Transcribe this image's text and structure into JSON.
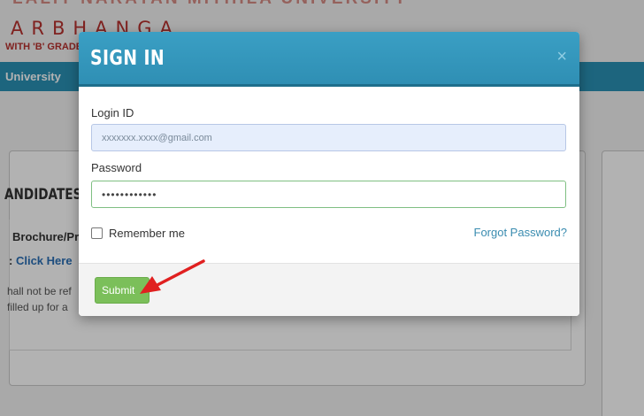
{
  "background": {
    "university_name": "LALIT NARAYAN MITHILA UNIVERSITY",
    "brand": "ARBHANGA",
    "grade": "WITH 'B' GRADE",
    "nav_item": "University",
    "card_title": "ANDIDATES I",
    "brochure_text": "Brochure/Pr",
    "click_prefix": ": ",
    "click_here": "Click Here",
    "notice_line1": "hall not be ref",
    "notice_line2": "filled up for a"
  },
  "modal": {
    "title": "SIGN IN",
    "close_glyph": "×",
    "login_label": "Login ID",
    "login_value": "xxxxxxx.xxxx@gmail.com",
    "password_label": "Password",
    "password_value": "••••••••••••",
    "remember_label": "Remember me",
    "forgot_label": "Forgot Password?",
    "submit_label": "Submit"
  },
  "colors": {
    "header": "#2f8fb4",
    "submit": "#7bbf5a",
    "arrow": "#e02020",
    "link": "#3a8cb0"
  }
}
